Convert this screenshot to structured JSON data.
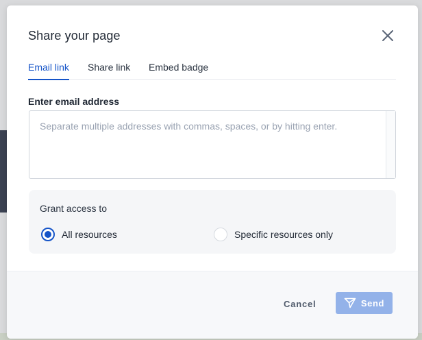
{
  "dialog": {
    "title": "Share your page"
  },
  "tabs": [
    {
      "label": "Email link",
      "active": true
    },
    {
      "label": "Share link",
      "active": false
    },
    {
      "label": "Embed badge",
      "active": false
    }
  ],
  "email": {
    "label": "Enter email address",
    "placeholder": "Separate multiple addresses with commas, spaces, or by hitting enter.",
    "value": ""
  },
  "access": {
    "title": "Grant access to",
    "options": [
      {
        "label": "All resources",
        "checked": true
      },
      {
        "label": "Specific resources only",
        "checked": false
      }
    ]
  },
  "footer": {
    "cancel_label": "Cancel",
    "send_label": "Send"
  },
  "icons": {
    "close": "close-icon",
    "send": "send-icon"
  },
  "colors": {
    "accent": "#1554c8",
    "send_button": "#93b2e9"
  }
}
